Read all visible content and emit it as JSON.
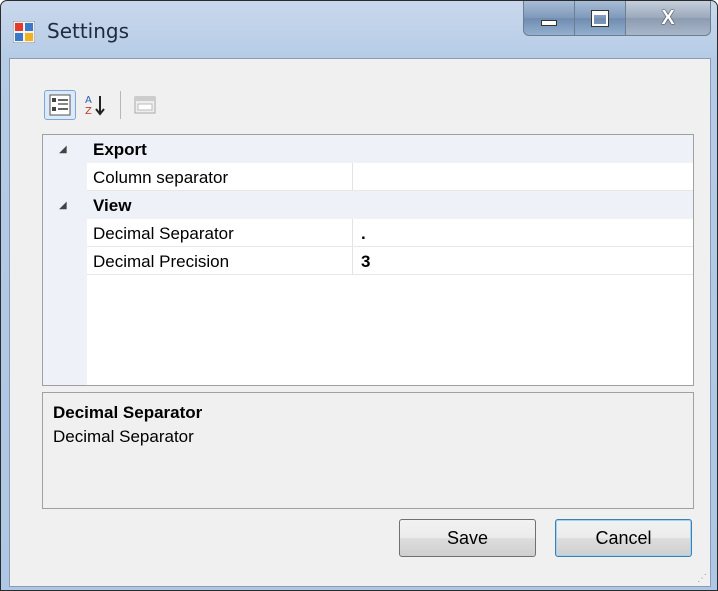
{
  "window": {
    "title": "Settings"
  },
  "caption_buttons": {
    "minimize": "▁",
    "maximize": "□",
    "close": "X"
  },
  "toolbar": [
    {
      "name": "categorized",
      "icon": "categorized-icon",
      "active": true
    },
    {
      "name": "alphabetical",
      "icon": "alphabetical-sort-icon",
      "active": false
    },
    {
      "name": "property-pages",
      "icon": "property-pages-icon",
      "active": false
    }
  ],
  "property_grid": {
    "categories": [
      {
        "label": "Export",
        "expanded": true,
        "properties": [
          {
            "name": "Column separator",
            "value": ""
          }
        ]
      },
      {
        "label": "View",
        "expanded": true,
        "properties": [
          {
            "name": "Decimal Separator",
            "value": "."
          },
          {
            "name": "Decimal Precision",
            "value": "3"
          }
        ]
      }
    ],
    "selected": "Decimal Separator"
  },
  "help": {
    "title": "Decimal Separator",
    "description": "Decimal Separator"
  },
  "buttons": {
    "save": "Save",
    "cancel": "Cancel"
  }
}
